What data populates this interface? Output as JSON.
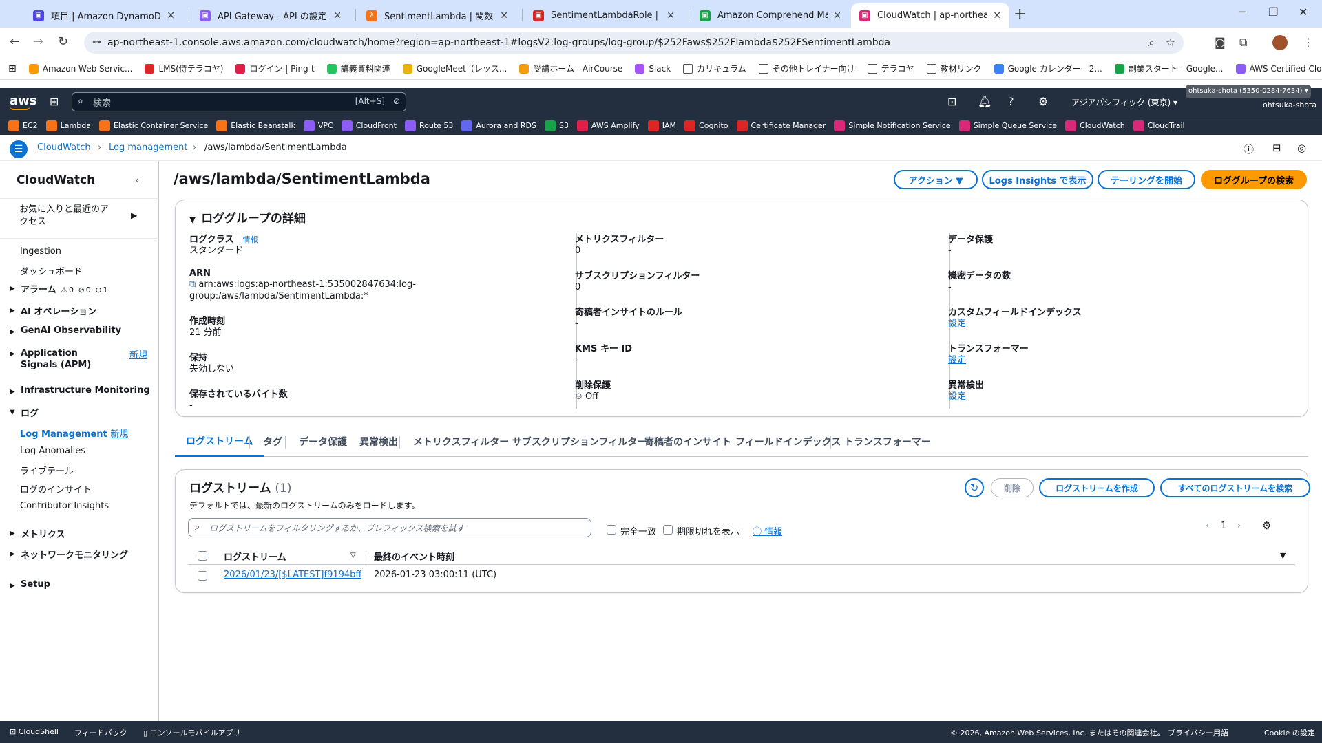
{
  "browser": {
    "tabs": [
      {
        "title": "項目 | Amazon DynamoDB Mana",
        "color": "#4f46e5"
      },
      {
        "title": "API Gateway - API の設定",
        "color": "#8b5cf6"
      },
      {
        "title": "SentimentLambda | 関数 | Lamb",
        "color": "#f97316"
      },
      {
        "title": "SentimentLambdaRole | IAM | G",
        "color": "#dc2626"
      },
      {
        "title": "Amazon Comprehend Managem",
        "color": "#16a34a"
      },
      {
        "title": "CloudWatch | ap-northeast-1",
        "color": "#db2777"
      }
    ],
    "url": "ap-northeast-1.console.aws.amazon.com/cloudwatch/home?region=ap-northeast-1#logsV2:log-groups/log-group/$252Faws$252Flambda$252FSentimentLambda",
    "bookmarks": [
      {
        "label": "Amazon Web Servic...",
        "color": "#ff9900"
      },
      {
        "label": "LMS(侍テラコヤ)",
        "color": "#dc2626"
      },
      {
        "label": "ログイン | Ping-t",
        "color": "#e11d48"
      },
      {
        "label": "講義資料関連",
        "color": "#22c55e"
      },
      {
        "label": "GoogleMeet（レッス...",
        "color": "#eab308"
      },
      {
        "label": "受講ホーム - AirCourse",
        "color": "#f59e0b"
      },
      {
        "label": "Slack",
        "color": "#a855f7"
      },
      {
        "label": "カリキュラム",
        "color": "#ffffff"
      },
      {
        "label": "その他トレイナー向け",
        "color": "#ffffff"
      },
      {
        "label": "テラコヤ",
        "color": "#ffffff"
      },
      {
        "label": "教材リンク",
        "color": "#ffffff"
      },
      {
        "label": "Google カレンダー - 2...",
        "color": "#3b82f6"
      },
      {
        "label": "副業スタート - Google...",
        "color": "#16a34a"
      },
      {
        "label": "AWS Certified Cloud...",
        "color": "#8b5cf6"
      }
    ]
  },
  "aws": {
    "logo": "aws",
    "search_placeholder": "検索",
    "search_shortcut": "[Alt+S]",
    "region": "アジアパシフィック (東京) ▾",
    "account": "ohtsuka-shota (5350-0284-7634) ▾",
    "user": "ohtsuka-shota",
    "services": [
      {
        "label": "EC2",
        "color": "#f97316"
      },
      {
        "label": "Lambda",
        "color": "#f97316"
      },
      {
        "label": "Elastic Container Service",
        "color": "#f97316"
      },
      {
        "label": "Elastic Beanstalk",
        "color": "#f97316"
      },
      {
        "label": "VPC",
        "color": "#8b5cf6"
      },
      {
        "label": "CloudFront",
        "color": "#8b5cf6"
      },
      {
        "label": "Route 53",
        "color": "#8b5cf6"
      },
      {
        "label": "Aurora and RDS",
        "color": "#6366f1"
      },
      {
        "label": "S3",
        "color": "#16a34a"
      },
      {
        "label": "AWS Amplify",
        "color": "#e11d48"
      },
      {
        "label": "IAM",
        "color": "#dc2626"
      },
      {
        "label": "Cognito",
        "color": "#dc2626"
      },
      {
        "label": "Certificate Manager",
        "color": "#dc2626"
      },
      {
        "label": "Simple Notification Service",
        "color": "#db2777"
      },
      {
        "label": "Simple Queue Service",
        "color": "#db2777"
      },
      {
        "label": "CloudWatch",
        "color": "#db2777"
      },
      {
        "label": "CloudTrail",
        "color": "#db2777"
      }
    ]
  },
  "breadcrumb": {
    "items": [
      "CloudWatch",
      "Log management",
      "/aws/lambda/SentimentLambda"
    ]
  },
  "sidebar": {
    "title": "CloudWatch",
    "favorites": "お気に入りと最近のアクセス",
    "items": {
      "ingestion": "Ingestion",
      "dashboard": "ダッシュボード",
      "alarm": "アラーム",
      "alarm_counts": [
        "0",
        "0",
        "1"
      ],
      "ai_ops": "AI オペレーション",
      "genai": "GenAI Observability",
      "app_signals": "Application Signals (APM)",
      "new": "新規",
      "infra": "Infrastructure Monitoring",
      "logs": "ログ",
      "log_mgmt": "Log Management",
      "log_anomalies": "Log Anomalies",
      "live_tail": "ライブテール",
      "log_insights": "ログのインサイト",
      "contributor": "Contributor Insights",
      "metrics": "メトリクス",
      "network": "ネットワークモニタリング",
      "setup": "Setup"
    }
  },
  "page": {
    "title": "/aws/lambda/SentimentLambda",
    "actions": "アクション ▼",
    "logs_insights": "Logs Insights で表示",
    "tailing": "テーリングを開始",
    "search_group": "ロググループの検索"
  },
  "details": {
    "title": "ロググループの詳細",
    "info": "情報",
    "col1": [
      {
        "label": "ログクラス",
        "value": "スタンダード"
      },
      {
        "label": "ARN",
        "value": "arn:aws:logs:ap-northeast-1:535002847634:log-group:/aws/lambda/SentimentLambda:*"
      },
      {
        "label": "作成時刻",
        "value": "21 分前"
      },
      {
        "label": "保持",
        "value": "失効しない"
      },
      {
        "label": "保存されているバイト数",
        "value": "-"
      }
    ],
    "col2": [
      {
        "label": "メトリクスフィルター",
        "value": "0"
      },
      {
        "label": "サブスクリプションフィルター",
        "value": "0"
      },
      {
        "label": "寄稿者インサイトのルール",
        "value": "-"
      },
      {
        "label": "KMS キー ID",
        "value": "-"
      },
      {
        "label": "削除保護",
        "value": "Off"
      }
    ],
    "col3": [
      {
        "label": "データ保護",
        "value": "-"
      },
      {
        "label": "機密データの数",
        "value": "-"
      },
      {
        "label": "カスタムフィールドインデックス",
        "value": "設定"
      },
      {
        "label": "トランスフォーマー",
        "value": "設定"
      },
      {
        "label": "異常検出",
        "value": "設定"
      }
    ]
  },
  "tabs": [
    "ログストリーム",
    "タグ",
    "データ保護",
    "異常検出",
    "メトリクスフィルター",
    "サブスクリプションフィルター",
    "寄稿者のインサイト",
    "フィールドインデックス",
    "トランスフォーマー"
  ],
  "streams": {
    "title": "ログストリーム",
    "count": "(1)",
    "desc": "デフォルトでは、最新のログストリームのみをロードします。",
    "filter_placeholder": "ログストリームをフィルタリングするか、プレフィックス検索を試す",
    "exact": "完全一致",
    "show_expired": "期限切れを表示",
    "info": "情報",
    "delete": "削除",
    "create": "ログストリームを作成",
    "search_all": "すべてのログストリームを検索",
    "page": "1",
    "col_stream": "ログストリーム",
    "col_time": "最終のイベント時刻",
    "rows": [
      {
        "stream": "2026/01/23/[$LATEST]f9194bff4",
        "time": "2026-01-23 03:00:11 (UTC)"
      }
    ]
  },
  "footer": {
    "cloudshell": "CloudShell",
    "feedback": "フィードバック",
    "mobile": "コンソールモバイルアプリ",
    "copyright": "© 2026, Amazon Web Services, Inc. またはその関連会社。",
    "privacy": "プライバシー",
    "terms": "用語",
    "cookie": "Cookie の設定"
  }
}
